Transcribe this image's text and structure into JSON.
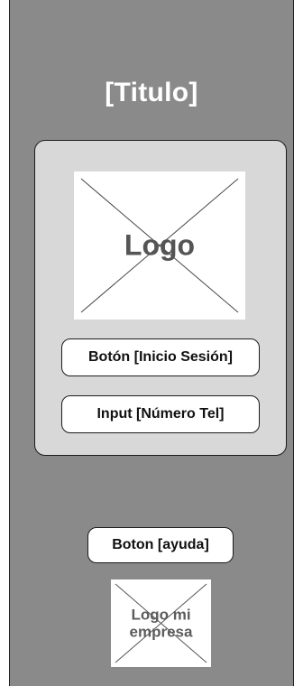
{
  "header": {
    "title": "[Titulo]"
  },
  "card": {
    "logo_label": "Logo",
    "login_button_label": "Botón [Inicio Sesión]",
    "phone_input_value": "Input [Número Tel]"
  },
  "footer": {
    "help_button_label": "Boton [ayuda]",
    "company_logo_label": "Logo mi empresa"
  },
  "colors": {
    "background": "#8a8a8a",
    "card": "#d8d8d8",
    "placeholder": "#ffffff",
    "text_light": "#ffffff"
  }
}
